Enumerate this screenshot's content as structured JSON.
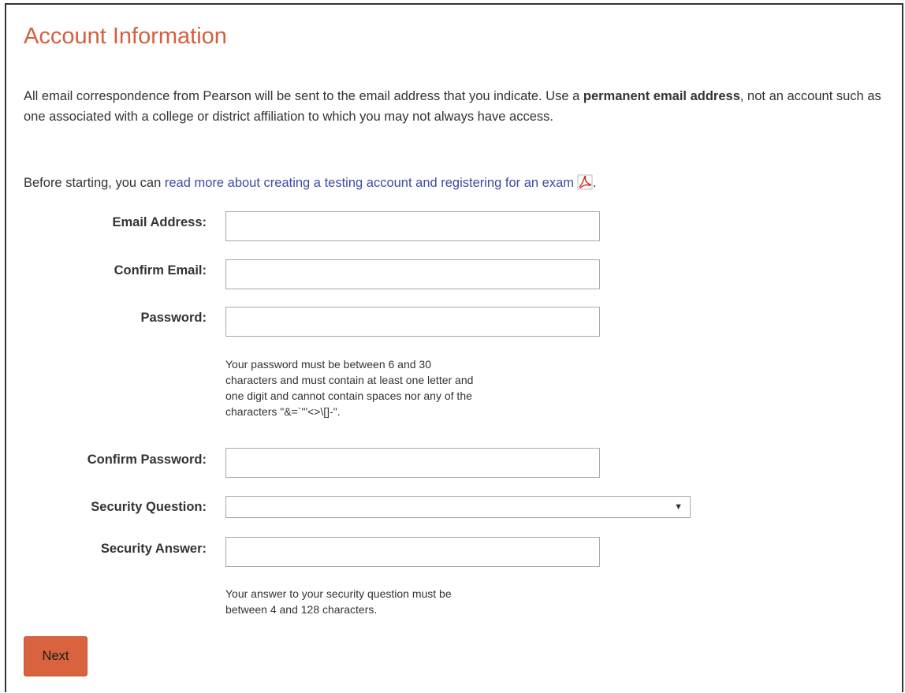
{
  "page": {
    "title": "Account Information",
    "intro_part1": "All email correspondence from Pearson will be sent to the email address that you indicate. Use a ",
    "intro_bold": "permanent email address",
    "intro_part2": ", not an account such as one associated with a college or district affiliation to which you may not always have access.",
    "before_text": "Before starting, you can ",
    "before_link": "read more about creating a testing account and registering for an exam",
    "before_end": "."
  },
  "form": {
    "email_label": "Email Address:",
    "email_value": "",
    "confirm_email_label": "Confirm Email:",
    "confirm_email_value": "",
    "password_label": "Password:",
    "password_value": "",
    "password_help_lines": [
      "Your password must be between 6 and 30",
      "characters and must contain at least one letter and",
      "one digit and cannot contain spaces nor any of the",
      "characters \"&=`'\"<>\\[]-\"."
    ],
    "confirm_password_label": "Confirm Password:",
    "confirm_password_value": "",
    "security_question_label": "Security Question:",
    "security_question_selected": "",
    "security_answer_label": "Security Answer:",
    "security_answer_value": "",
    "answer_help_lines": [
      "Your answer to your security question must be",
      "between 4 and 128 characters."
    ],
    "next_label": "Next"
  },
  "icons": {
    "pdf": "pdf-icon",
    "dropdown": "dropdown-arrow-icon"
  },
  "colors": {
    "title": "#d4603e",
    "link": "#3c4ca3",
    "button": "#d9633e",
    "pdf_icon": "#cc2a1e"
  }
}
